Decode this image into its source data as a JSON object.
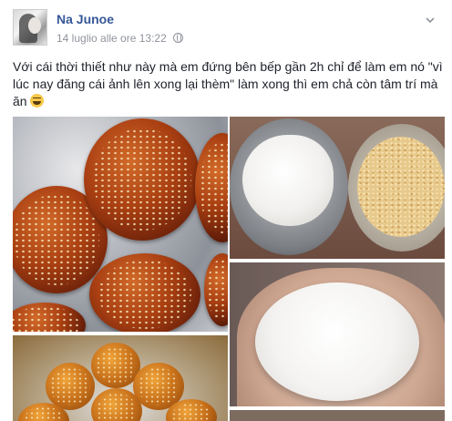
{
  "post": {
    "author": "Na Junoe",
    "timestamp": "14 luglio alle ore 13:22",
    "text": "Với cái thời thiết như này mà em đứng bên bếp gần 2h chỉ để làm em nó \"vì lúc nay đăng cái ảnh lên xong lại thèm\" làm xong thì em chả còn tâm trí mà ăn",
    "emoji": "laughing-emoji",
    "photos": [
      {
        "name": "fried-sesame-cakes-photo"
      },
      {
        "name": "dough-and-crumbs-photo"
      },
      {
        "name": "dough-in-hand-photo"
      },
      {
        "name": "fried-balls-basket-photo"
      },
      {
        "name": "partial-photo"
      }
    ]
  },
  "colors": {
    "author_link": "#365899",
    "meta_text": "#90949c",
    "body_text": "#1d2129"
  }
}
